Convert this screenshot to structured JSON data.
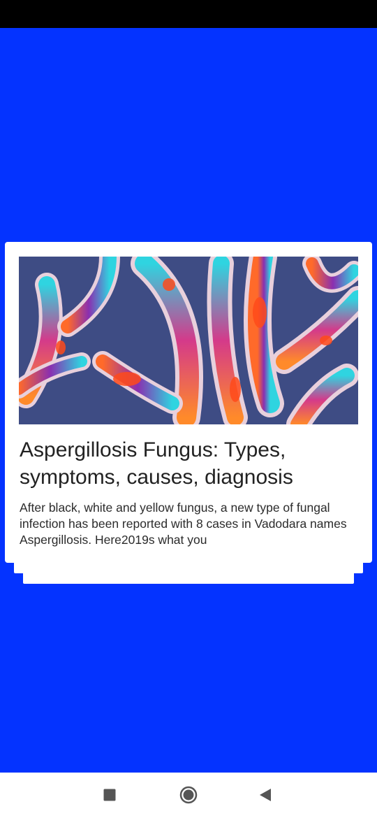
{
  "article": {
    "title": "Aspergillosis Fungus: Types, symptoms, causes, diagnosis",
    "description": "After black, white and yellow fungus, a new type of fungal infection has been reported with 8 cases in Vadodara names Aspergillosis. Here2019s what you"
  },
  "colors": {
    "background": "#0433ff",
    "status_bar": "#000000",
    "card": "#ffffff",
    "nav_bar": "#ffffff",
    "nav_icon": "#555555"
  },
  "navigation": {
    "recents_icon": "square-icon",
    "home_icon": "circle-icon",
    "back_icon": "triangle-back-icon"
  }
}
